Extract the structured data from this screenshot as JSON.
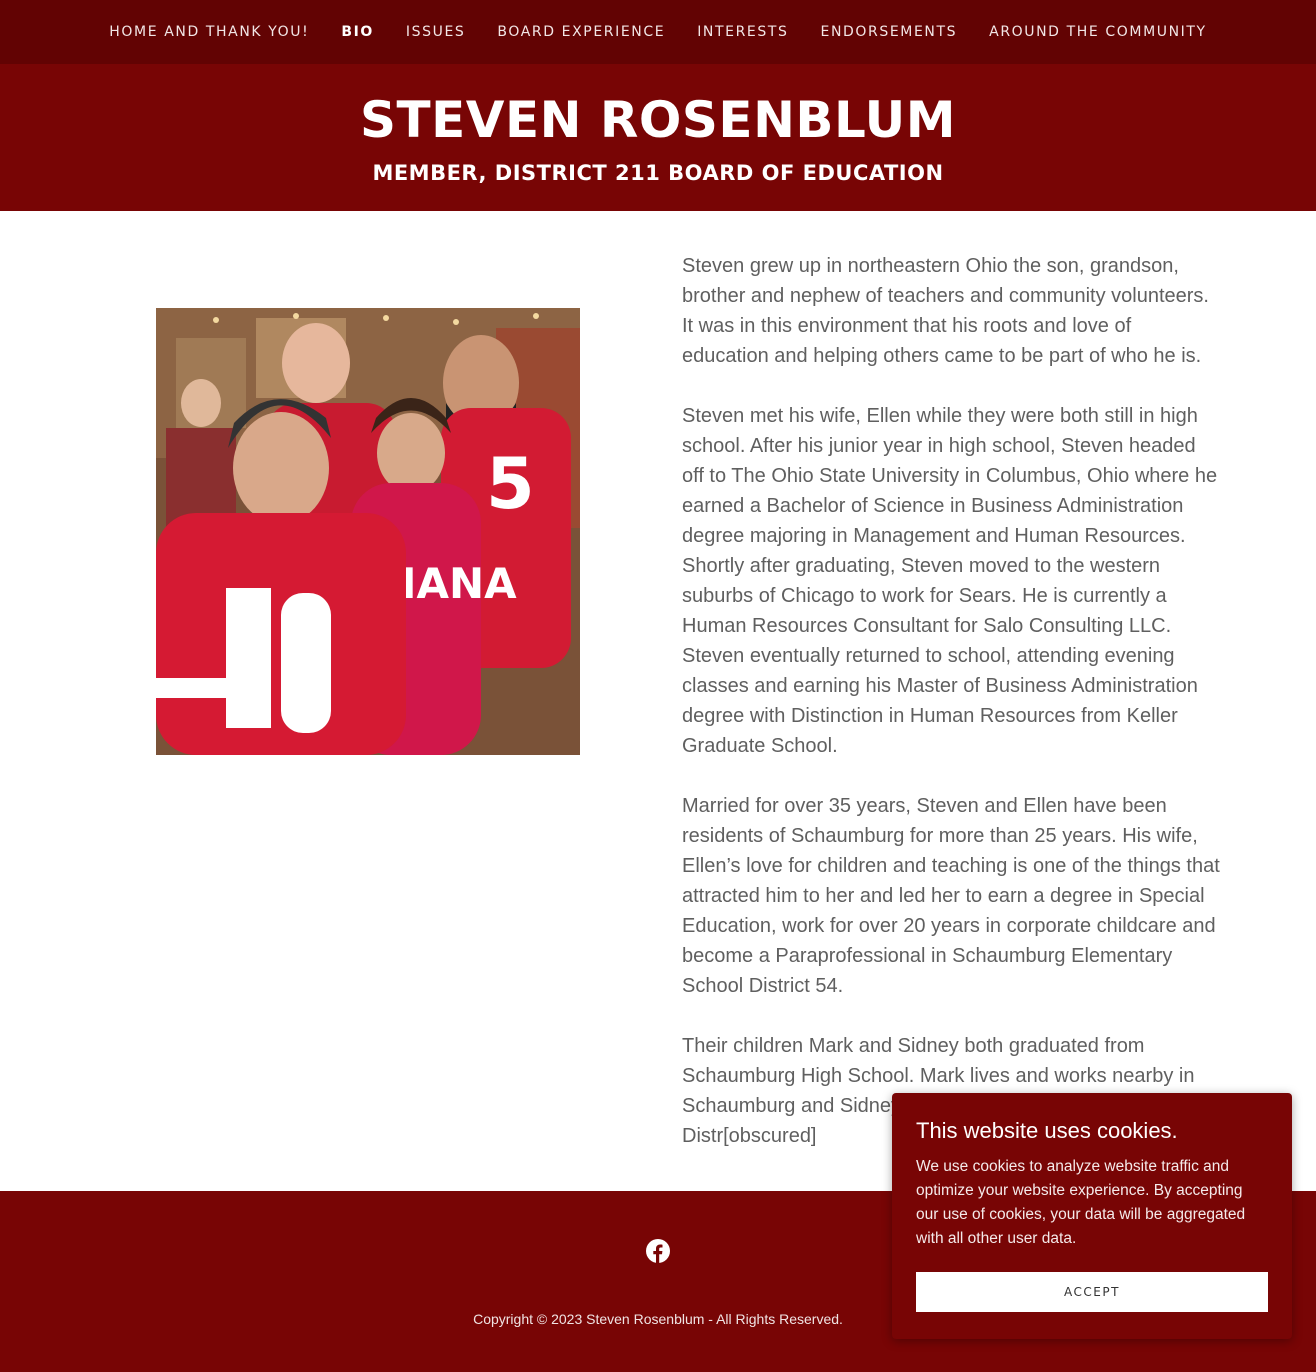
{
  "nav": {
    "items": [
      {
        "label": "HOME AND THANK YOU!",
        "active": false
      },
      {
        "label": "BIO",
        "active": true
      },
      {
        "label": "ISSUES",
        "active": false
      },
      {
        "label": "BOARD EXPERIENCE",
        "active": false
      },
      {
        "label": "INTERESTS",
        "active": false
      },
      {
        "label": "ENDORSEMENTS",
        "active": false
      },
      {
        "label": "AROUND THE COMMUNITY",
        "active": false
      }
    ]
  },
  "hero": {
    "title": "STEVEN ROSENBLUM",
    "subtitle": "MEMBER, DISTRICT 211 BOARD OF EDUCATION"
  },
  "bio": {
    "paragraphs": [
      "Steven grew up in northeastern Ohio the son, grandson, brother and nephew of teachers and community volunteers. It was in this environment that his roots and love of education and helping others came to be part of who he is.",
      "Steven met his wife, Ellen while they were both still in high school. After his junior year in high school, Steven headed off to The Ohio State University in Columbus, Ohio where he earned a Bachelor of Science in Business Administration degree majoring in Management and Human Resources. Shortly after graduating, Steven moved to the western suburbs of Chicago to work for Sears. He is currently a Human Resources Consultant for Salo Consulting LLC. Steven eventually returned to school, attending evening classes and earning his Master of Business Administration degree with Distinction in Human Resources from Keller Graduate School.",
      "Married for over 35 years, Steven and Ellen have been residents of Schaumburg for more than 25 years. His wife, Ellen’s love for children and teaching is one of the things that attracted him to her and led her to earn a degree in Special Education, work for over 20 years in corporate childcare and become a Paraprofessional in Schaumburg Elementary School District 54.",
      "Their children Mark and Sidney both graduated from Schaumburg High School. Mark lives and works nearby in Schaumburg and Sidney [obscured] Elementary School Distr[obscured]"
    ]
  },
  "footer": {
    "social_icon": "facebook-icon",
    "copyright": "Copyright © 2023 Steven Rosenblum - All Rights Reserved."
  },
  "cookie": {
    "title": "This website uses cookies.",
    "body": "We use cookies to analyze website traffic and optimize your website experience. By accepting our use of cookies, your data will be aggregated with all other user data.",
    "accept_label": "ACCEPT"
  },
  "colors": {
    "nav_bg": "#620303",
    "brand_red": "#780505",
    "body_text": "#5f5f5f"
  }
}
